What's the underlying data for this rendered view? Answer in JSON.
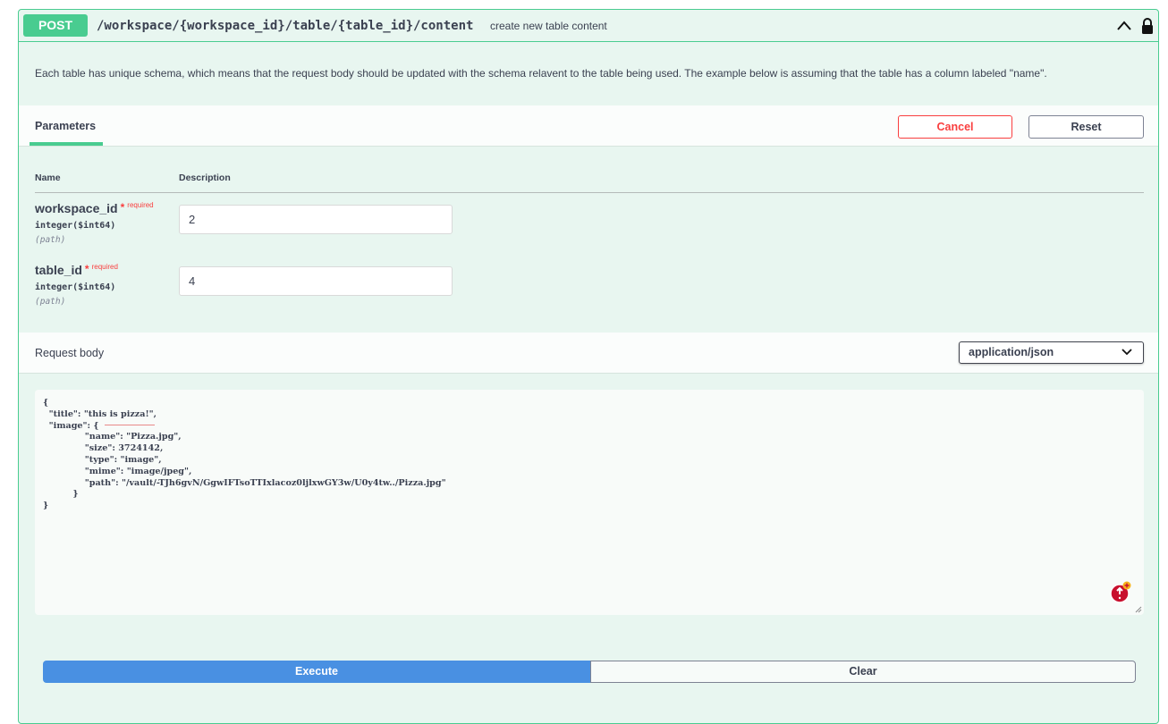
{
  "operation": {
    "method": "POST",
    "path": "/workspace/{workspace_id}/table/{table_id}/content",
    "summary": "create new table content",
    "description": "Each table has unique schema, which means that the request body should be updated with the schema relavent to the table being used. The example below is assuming that the table has a column labeled \"name\"."
  },
  "tabs": {
    "parameters_label": "Parameters"
  },
  "actions": {
    "cancel_label": "Cancel",
    "reset_label": "Reset",
    "execute_label": "Execute",
    "clear_label": "Clear"
  },
  "params_table": {
    "col_name": "Name",
    "col_description": "Description",
    "rows": [
      {
        "name": "workspace_id",
        "star": "*",
        "required": "required",
        "type": "integer($int64)",
        "in": "(path)",
        "value": "2"
      },
      {
        "name": "table_id",
        "star": "*",
        "required": "required",
        "type": "integer($int64)",
        "in": "(path)",
        "value": "4"
      }
    ]
  },
  "request_body": {
    "label": "Request body",
    "content_type": "application/json",
    "body": "{\n  \"title\": \"this is pizza!\",\n  \"image\": {\n              \"name\": \"Pizza.jpg\",\n              \"size\": 3724142,\n              \"type\": \"image\",\n              \"mime\": \"image/jpeg\",\n              \"path\": \"/vault/-TJh6gvN/GgwIFTsoTTIxlacoz0ljlxwGY3w/U0y4tw../Pizza.jpg\"\n          }\n}"
  },
  "colors": {
    "post_green": "#49cc90",
    "execute_blue": "#4990e2",
    "cancel_red": "#f93e3e"
  },
  "icons": [
    "chevron-up-icon",
    "lock-icon",
    "chevron-down-icon",
    "grammar-check-icon"
  ]
}
